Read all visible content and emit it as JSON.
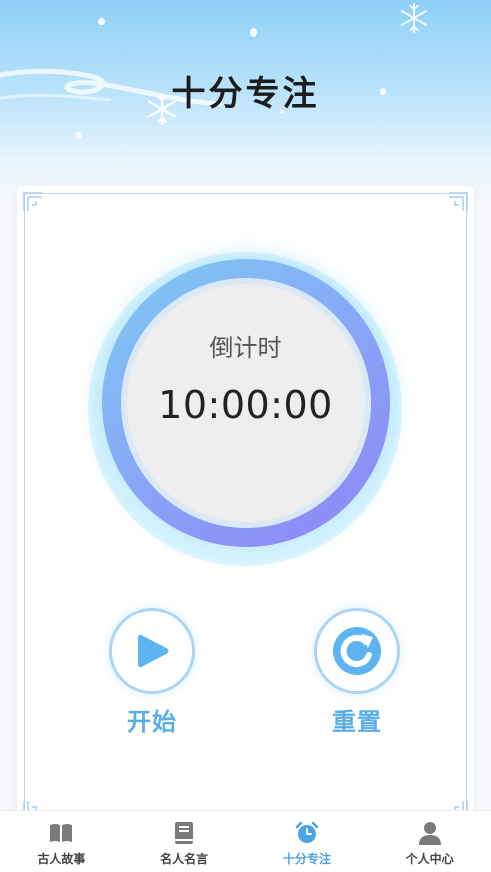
{
  "header": {
    "title": "十分专注"
  },
  "timer": {
    "label": "倒计时",
    "value": "10:00:00"
  },
  "controls": {
    "start_label": "开始",
    "reset_label": "重置"
  },
  "tabbar": {
    "items": [
      {
        "label": "古人故事",
        "icon": "book-icon",
        "active": false
      },
      {
        "label": "名人名言",
        "icon": "notebook-icon",
        "active": false
      },
      {
        "label": "十分专注",
        "icon": "alarm-clock-icon",
        "active": true
      },
      {
        "label": "个人中心",
        "icon": "user-icon",
        "active": false
      }
    ]
  },
  "colors": {
    "accent": "#4aa3e6",
    "ring_start": "#7ecbf3",
    "ring_end": "#8f83f6",
    "button_label": "#5aaee8"
  }
}
